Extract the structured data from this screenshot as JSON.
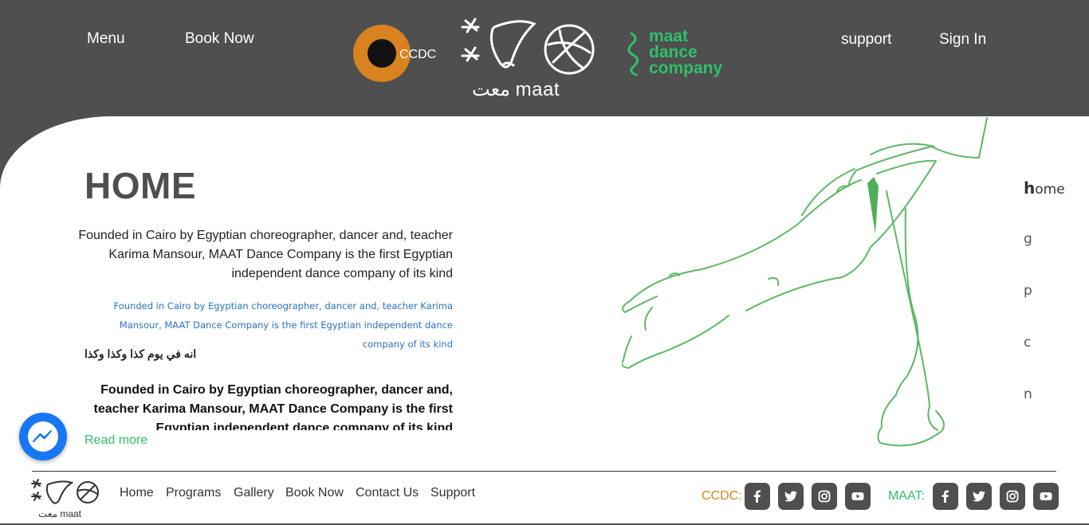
{
  "header": {
    "menu_label": "Menu",
    "book_label": "Book Now",
    "support_label": "support",
    "signin_label": "Sign In",
    "ccdc_text": "CCDC",
    "maat_text": "معت maat",
    "mdc_lines": [
      "maat",
      "dance",
      "company"
    ]
  },
  "main": {
    "title": "HOME",
    "p1": "Founded in Cairo by Egyptian choreographer, dancer and, teacher Karima Mansour, MAAT Dance Company is the first Egyptian independent dance company of its kind",
    "p2": "Founded in Cairo by Egyptian choreographer, dancer and, teacher Karima Mansour, MAAT Dance Company is the first Egyptian independent dance company of its kind",
    "p3": "انه في يوم كذا وكذا وكذا",
    "p4": "Founded in Cairo by Egyptian choreographer, dancer and, teacher Karima Mansour, MAAT Dance Company is the first Egyptian independent dance company of its kind",
    "read_more": "Read more"
  },
  "side_nav": [
    {
      "first": "h",
      "rest": "ome"
    },
    {
      "first": "g",
      "rest": ""
    },
    {
      "first": "p",
      "rest": ""
    },
    {
      "first": "c",
      "rest": ""
    },
    {
      "first": "n",
      "rest": ""
    }
  ],
  "footer": {
    "logo_text": "معت maat",
    "links": [
      "Home",
      "Programs",
      "Gallery",
      "Book Now",
      "Contact Us",
      "Support"
    ],
    "ccdc_label": "CCDC:",
    "maat_label": "MAAT:"
  },
  "colors": {
    "header_bg": "#4f4f4f",
    "ccdc_orange": "#d98220",
    "maat_green": "#2fc06a",
    "link_blue": "#2a73c2"
  }
}
